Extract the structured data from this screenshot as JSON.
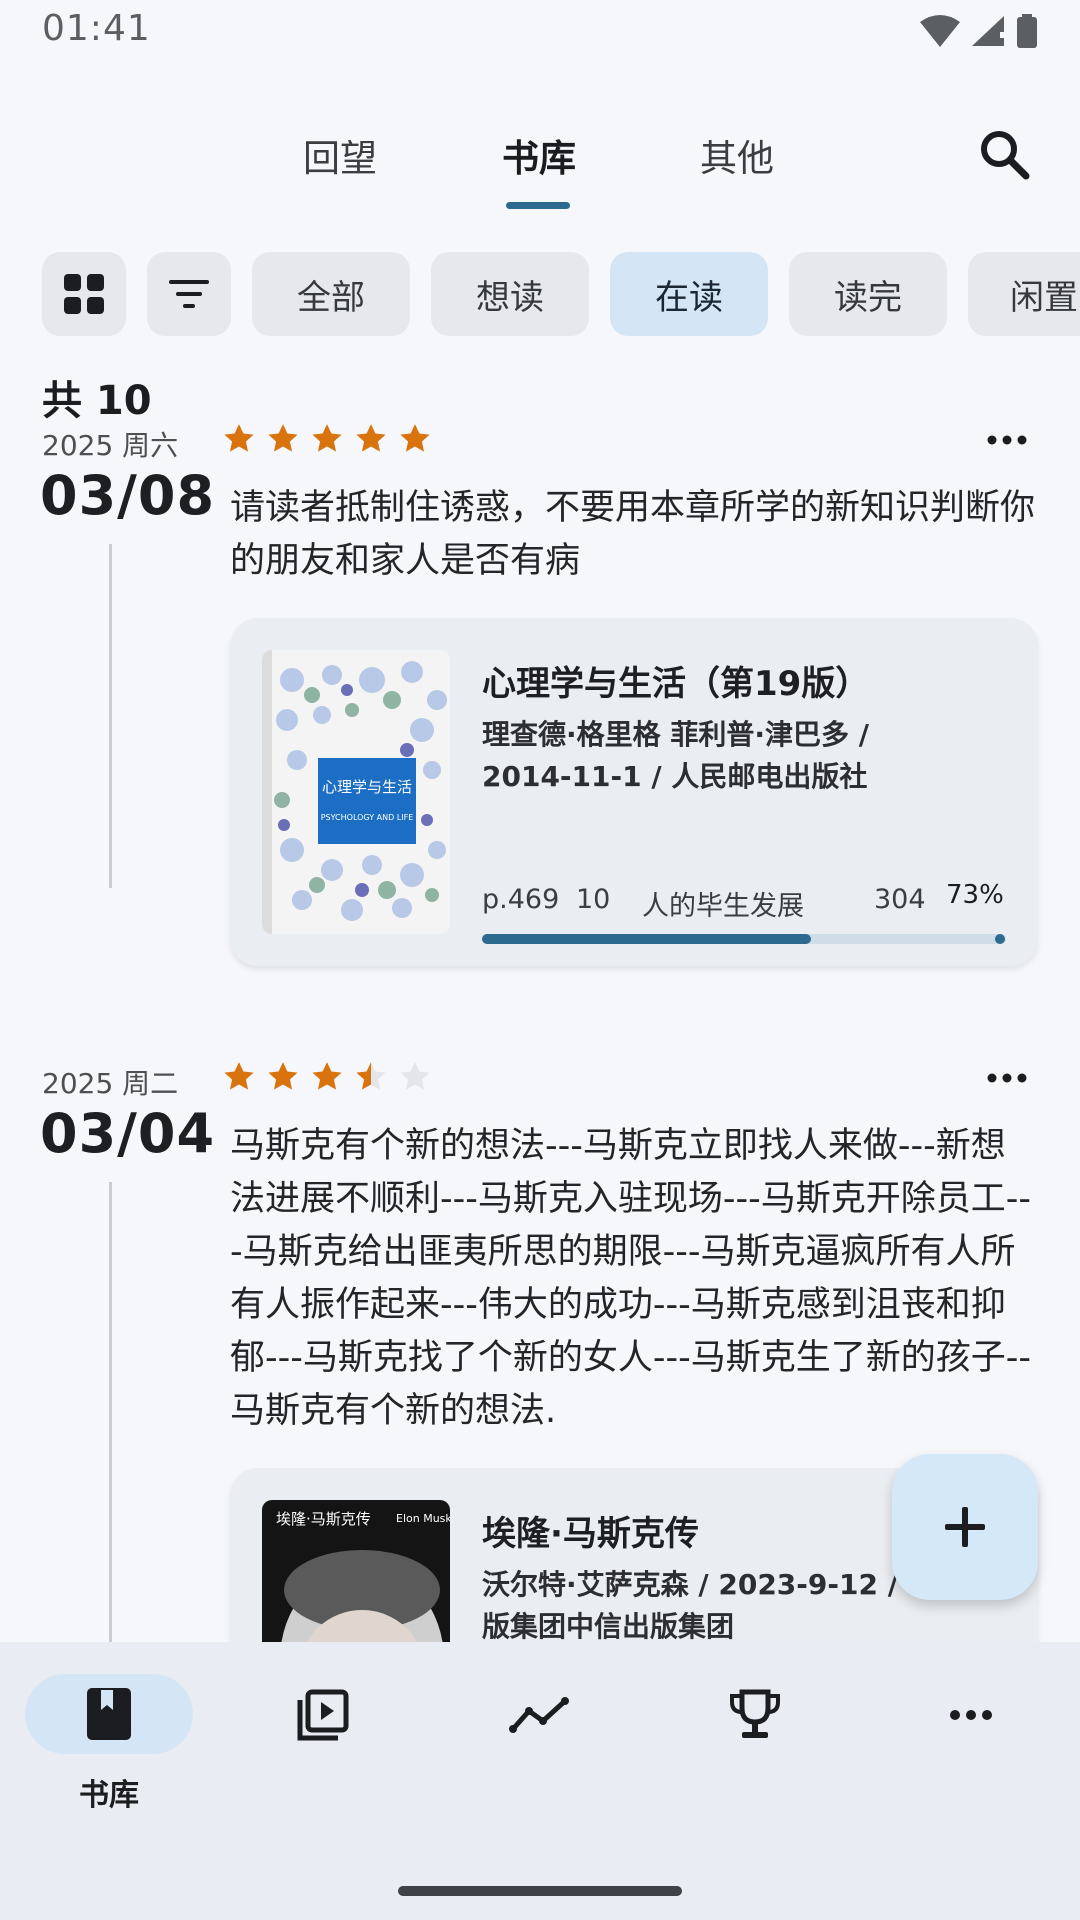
{
  "status_bar": {
    "time": "01:41"
  },
  "top_tabs": [
    {
      "label": "回望"
    },
    {
      "label": "书库",
      "active": true
    },
    {
      "label": "其他"
    }
  ],
  "filters": {
    "chips": [
      {
        "label": "全部"
      },
      {
        "label": "想读"
      },
      {
        "label": "在读",
        "active": true
      },
      {
        "label": "读完"
      },
      {
        "label": "闲置"
      }
    ]
  },
  "total_count": "共 10",
  "entries": [
    {
      "date_sub": "2025 周六",
      "date_main": "03/08",
      "rating": 5,
      "note": "请读者抵制住诱惑，不要用本章所学的新知识判断你的朋友和家人是否有病",
      "book": {
        "title": "心理学与生活（第19版）",
        "meta_line1": "理查德·格里格  菲利普·津巴多 /",
        "meta_line2": "2014-11-1 / 人民邮电出版社",
        "cover_title": "心理学与生活",
        "cover_subtitle": "PSYCHOLOGY AND LIFE",
        "current_page": "p.469",
        "chapter_no": "10",
        "chapter": "人的毕生发展",
        "chapter_pages": "304",
        "percent": "73%",
        "progress": 0.73
      }
    },
    {
      "date_sub": "2025 周二",
      "date_main": "03/04",
      "rating": 3.5,
      "note": "马斯克有个新的想法---马斯克立即找人来做---新想法进展不顺利---马斯克入驻现场---马斯克开除员工---马斯克给出匪夷所思的期限---马斯克逼疯所有人所有人振作起来---伟大的成功---马斯克感到沮丧和抑郁---马斯克找了个新的女人---马斯克生了新的孩子--马斯克有个新的想法.",
      "book": {
        "title": "埃隆·马斯克传",
        "meta_line1": "沃尔特·艾萨克森 / 2023-9-12 / 中",
        "meta_line2": "版集团中信出版集团",
        "cover_title": "埃隆·马斯克传",
        "cover_en": "Elon Musk"
      }
    }
  ],
  "bottom_nav": [
    {
      "label": "书库",
      "icon": "book-icon",
      "active": true
    },
    {
      "label": "",
      "icon": "video-library-icon"
    },
    {
      "label": "",
      "icon": "chart-line-icon"
    },
    {
      "label": "",
      "icon": "trophy-icon"
    },
    {
      "label": "",
      "icon": "more-icon"
    }
  ],
  "colors": {
    "accent": "#2c6a8f",
    "star": "#d9730d",
    "chip_active": "#d4e6f6",
    "progress": "#2c6a8f"
  }
}
